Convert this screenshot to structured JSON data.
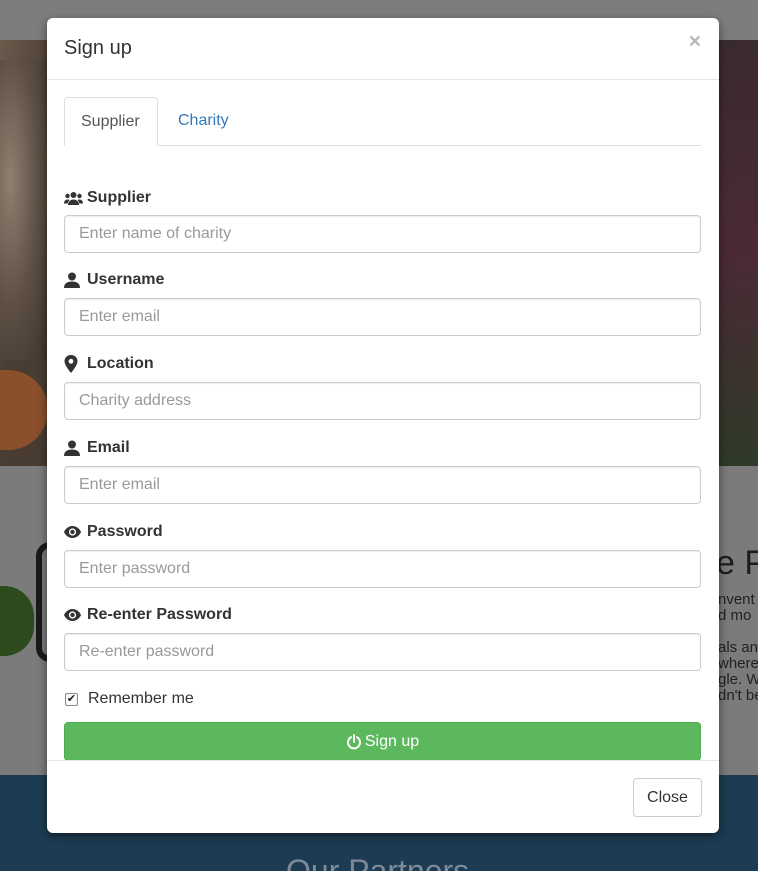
{
  "background": {
    "heading_fragment": "e P",
    "text_fragments": [
      "nvent",
      "d mo",
      "",
      "als an",
      "where",
      "gle. W",
      "dn't be"
    ],
    "footer_title": "Our Partners"
  },
  "modal": {
    "title": "Sign up",
    "close_glyph": "×",
    "tabs": [
      {
        "label": "Supplier",
        "active": true
      },
      {
        "label": "Charity",
        "active": false
      }
    ],
    "fields": {
      "supplier": {
        "label": "Supplier",
        "icon": "users-icon",
        "placeholder": "Enter name of charity",
        "value": ""
      },
      "username": {
        "label": "Username",
        "icon": "user-icon",
        "placeholder": "Enter email",
        "value": ""
      },
      "location": {
        "label": "Location",
        "icon": "map-marker-icon",
        "placeholder": "Charity address",
        "value": ""
      },
      "email": {
        "label": "Email",
        "icon": "user-icon",
        "placeholder": "Enter email",
        "value": ""
      },
      "password": {
        "label": "Password",
        "icon": "eye-icon",
        "placeholder": "Enter password",
        "value": ""
      },
      "reenter_password": {
        "label": "Re-enter Password",
        "icon": "eye-icon",
        "placeholder": "Re-enter password",
        "value": ""
      }
    },
    "remember_me": {
      "label": "Remember me",
      "checked": true
    },
    "signup_button": {
      "label": "Sign up",
      "icon": "power-icon"
    },
    "close_button": {
      "label": "Close"
    }
  },
  "colors": {
    "primary_link": "#337ab7",
    "success": "#5cb85c",
    "overlay_footer": "#1d3b52"
  }
}
